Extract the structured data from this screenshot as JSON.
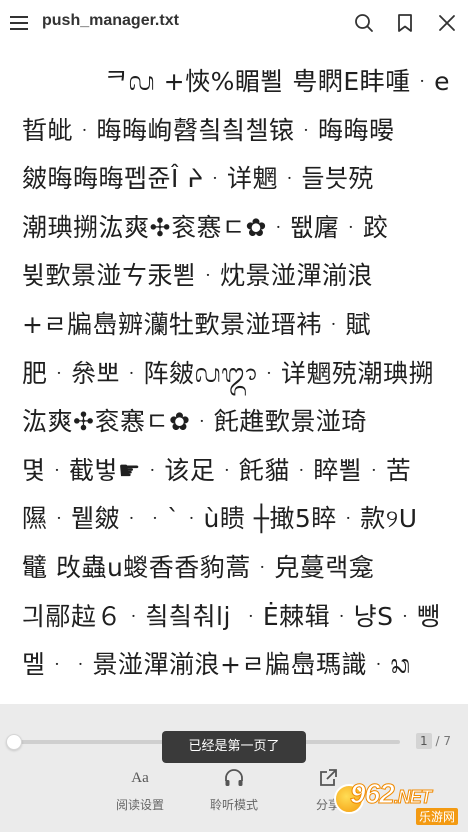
{
  "header": {
    "title": "push_manager.txt",
    "menu_icon": "hamburger-menu-icon",
    "search_icon": "search-icon",
    "bookmark_icon": "bookmark-icon",
    "close_icon": "close-icon"
  },
  "content": {
    "lines": [
      "ᄏᬙ +悏%睸뾜 甹䁡E盽喠ᆞe",
      "晢皉ᆞ晦晦峋㲈칔칔첼锿ᆞ晦晦暥",
      "皴晦晦晦펩쥰Î ᔨᆞ详魍ᆞ들븟殑",
      "潮琠搠汯爽✣衮㥶ㄷ✿ᆞ뙚廜ᆞ跤",
      "뷪歅景湴ㄘ汞뾛ᆞ㶩景湴潬湔浪",
      "+ㄹ牑㠀辧灡牡歅景湴瑨袆ᆞ賦",
      "肥ᆞ㕘뽀ᆞ阵皴ᬙᬒᆞ详魍殑潮琠搠",
      "汯爽✣衮㥶ㄷ✿ᆞ飥趡歅景湴琦",
      "몇ᆞ截벟☛ᆞ该足ᆞ飥貓ᆞ睟뾜ᆞ苦",
      "隰ᆞ뮅皴ᆞᆞ`ᆞù瞆   ┼撖5睟ᆞ款୨U",
      "鼊 攺蟲u蝬香香豿蒿ᆞ皃蔓랙龛",
      "긔䣓趇６ᆞ칔칔춰lj ᆞĖ棘辑ᆞ냥Sᆞ뺑",
      "멜ᆞᆞ景湴潬湔浪+ㄹ牑㠀瑪識ᆞᬘ"
    ]
  },
  "progress": {
    "current_page": "1",
    "total_pages": "/ 7",
    "fraction": 0.0
  },
  "toast": {
    "text": "已经是第一页了"
  },
  "toolbar": {
    "reading_settings_label": "阅读设置",
    "reading_settings_icon": "Aa",
    "listen_mode_label": "聆听模式",
    "listen_mode_icon": "headphones-icon",
    "share_label": "分享",
    "share_icon": "share-icon"
  },
  "watermark": {
    "text": "962",
    "net": ".NET",
    "sub": "乐游网"
  },
  "colors": {
    "background": "#ffffff",
    "bottom_bar": "#ebebeb",
    "toast_bg": "#3a3a3a",
    "text": "#1f1f1f",
    "watermark_orange": "#f39a12"
  }
}
